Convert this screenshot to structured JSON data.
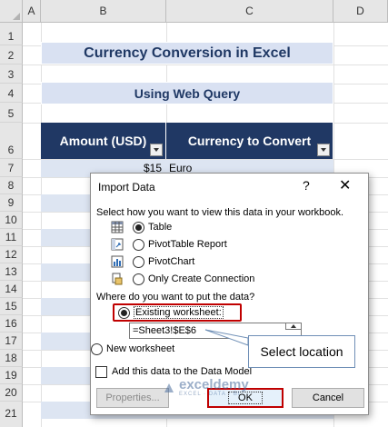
{
  "sheet": {
    "columns": [
      "A",
      "B",
      "C",
      "D"
    ],
    "rows": [
      "1",
      "2",
      "3",
      "4",
      "5",
      "6",
      "7",
      "8",
      "9",
      "10",
      "11",
      "12",
      "13",
      "14",
      "15",
      "16",
      "17",
      "18",
      "19",
      "20",
      "21"
    ],
    "title": "Currency Conversion in Excel",
    "subtitle": "Using Web Query",
    "table_headers": [
      "Amount (USD)",
      "Currency to Convert"
    ],
    "row7": {
      "amount": "$15",
      "currency": "Euro"
    }
  },
  "dialog": {
    "title": "Import Data",
    "help": "?",
    "close": "✕",
    "prompt": "Select how you want to view this data in your workbook.",
    "view_options": [
      {
        "label": "Table",
        "icon": "table-icon",
        "selected": true
      },
      {
        "label": "PivotTable Report",
        "icon": "pivottable-icon",
        "selected": false
      },
      {
        "label": "PivotChart",
        "icon": "pivotchart-icon",
        "selected": false
      },
      {
        "label": "Only Create Connection",
        "icon": "connection-icon",
        "selected": false
      }
    ],
    "where_prompt": "Where do you want to put the data?",
    "existing_worksheet": "Existing worksheet:",
    "reference": "=Sheet3!$E$6",
    "new_worksheet": "New worksheet",
    "add_to_model": "Add this data to the Data Model",
    "properties_button": "Properties...",
    "ok_button": "OK",
    "cancel_button": "Cancel"
  },
  "callout": "Select location",
  "watermark": {
    "main": "exceldemy",
    "sub": "EXCEL · DATA · BI"
  },
  "colors": {
    "header_navy": "#203864",
    "band_blue": "#d9e1f2",
    "title_text": "#1f3864",
    "highlight_red": "#c00000"
  }
}
